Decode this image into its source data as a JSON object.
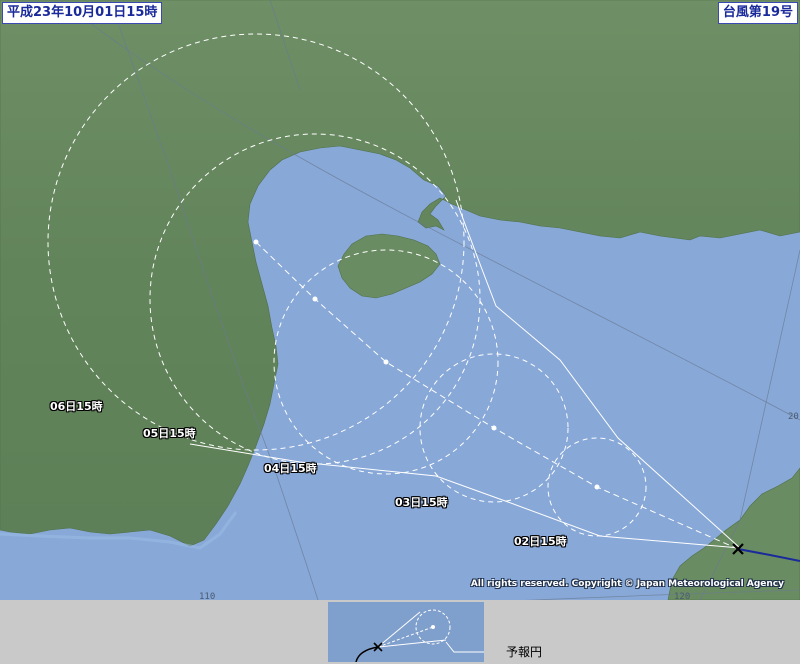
{
  "header": {
    "datetime": "平成23年10月01日15時",
    "typhoon_name": "台風第19号"
  },
  "forecast_labels": [
    {
      "id": "02",
      "text": "02日15時"
    },
    {
      "id": "03",
      "text": "03日15時"
    },
    {
      "id": "04",
      "text": "04日15時"
    },
    {
      "id": "05",
      "text": "05日15時"
    },
    {
      "id": "06",
      "text": "06日15時"
    }
  ],
  "grid": {
    "lon_110": "110",
    "lon_120": "120",
    "lat_20": "20"
  },
  "copyright": "All rights reserved. Copyright © Japan Meteorological Agency",
  "legend": {
    "label": "予報円"
  },
  "colors": {
    "sea": "#88a8d8",
    "land": "#6e8e64",
    "track": "#ffffff",
    "past_track": "#1a2a9a",
    "label_border": "#3a4ab0"
  },
  "icons": {
    "current_position": "cross-icon",
    "forecast_center": "dot-icon"
  }
}
